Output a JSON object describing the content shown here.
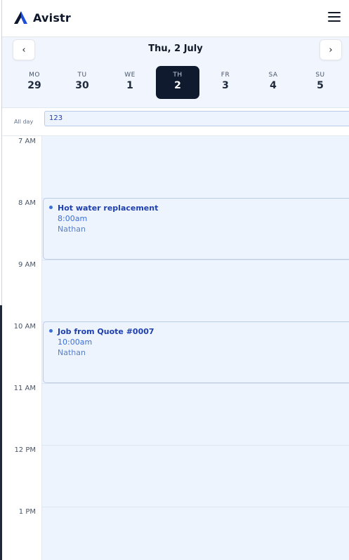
{
  "app": {
    "name": "Avistr"
  },
  "datebar": {
    "prev_label": "‹",
    "next_label": "›",
    "current_date": "Thu, 2 July",
    "days": [
      {
        "name": "MO",
        "num": "29"
      },
      {
        "name": "TU",
        "num": "30"
      },
      {
        "name": "WE",
        "num": "1"
      },
      {
        "name": "TH",
        "num": "2"
      },
      {
        "name": "FR",
        "num": "3"
      },
      {
        "name": "SA",
        "num": "4"
      },
      {
        "name": "SU",
        "num": "5"
      }
    ],
    "active_day": "TH"
  },
  "allday": {
    "label": "All day",
    "event": "123"
  },
  "hours": [
    "7 AM",
    "8 AM",
    "9 AM",
    "10 AM",
    "11 AM",
    "12 PM",
    "1 PM"
  ],
  "events": [
    {
      "title": "Hot water replacement",
      "time": "8:00am",
      "person": "Nathan"
    },
    {
      "title": "Job from Quote #0007",
      "time": "10:00am",
      "person": "Nathan"
    }
  ],
  "colors": {
    "accent": "#1e40af",
    "event_bg": "#eef4fe",
    "active_day_bg": "#0f1a2e"
  },
  "icons": {
    "logo": "avistr-logo-icon",
    "menu": "hamburger-menu-icon",
    "event_marker": "dot-icon"
  }
}
